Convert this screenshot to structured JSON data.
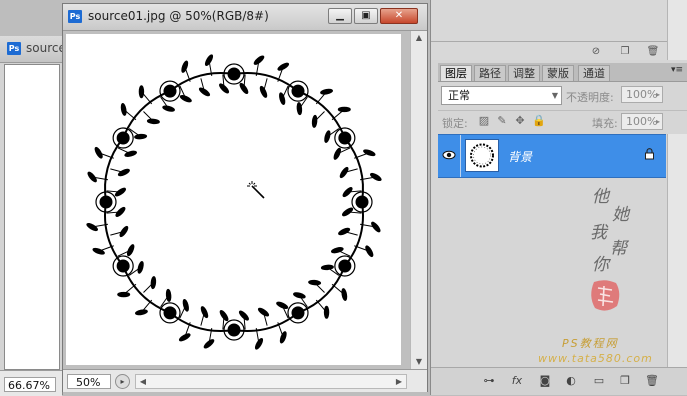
{
  "back_window": {
    "app_icon": "Ps",
    "title": "source",
    "zoom": "66.67%"
  },
  "document": {
    "app_icon": "Ps",
    "title": "source01.jpg @ 50%(RGB/8#)",
    "zoom": "50%",
    "buttons": {
      "minimize": "▁",
      "restore": "▣",
      "close": "✕"
    },
    "cursor_icon": "magic-wand-icon"
  },
  "layers_panel": {
    "tabs": [
      {
        "label": "图层",
        "active": true
      },
      {
        "label": "路径",
        "active": false
      },
      {
        "label": "调整",
        "active": false
      },
      {
        "label": "蒙版",
        "active": false
      },
      {
        "label": "通道",
        "active": false
      }
    ],
    "blend_mode": "正常",
    "opacity_label": "不透明度:",
    "opacity_value": "100%",
    "lock_label": "锁定:",
    "fill_label": "填充:",
    "fill_value": "100%",
    "layers": [
      {
        "name": "背景",
        "selected": true,
        "visible": true,
        "locked": true
      }
    ],
    "accent_color": "#3e8ee8"
  },
  "watermark": {
    "signature": [
      "他",
      "她",
      "我",
      "帮",
      "你"
    ],
    "site_name": "PS教程网",
    "url": "www.tata580.com"
  }
}
